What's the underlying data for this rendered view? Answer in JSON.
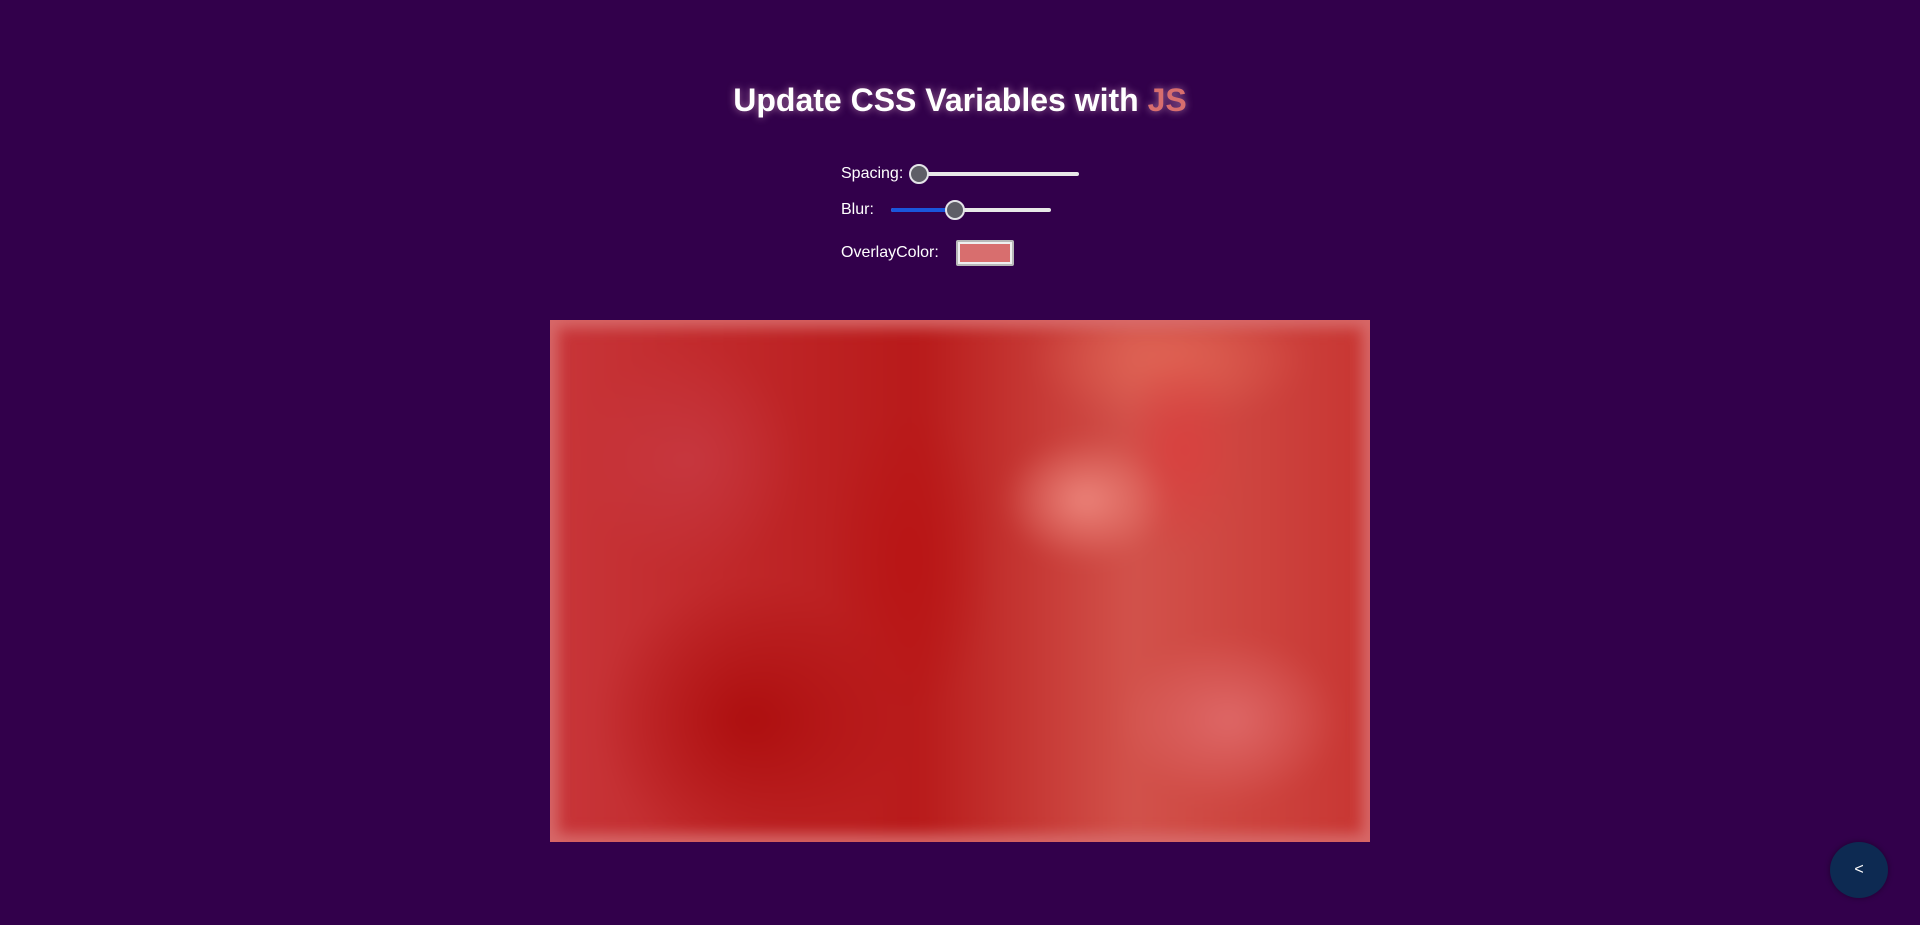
{
  "title": {
    "text": "Update CSS Variables with ",
    "highlight": "JS"
  },
  "controls": {
    "spacing": {
      "label": "Spacing:",
      "value": 0,
      "min": 0,
      "max": 200
    },
    "blur": {
      "label": "Blur:",
      "value": 10,
      "min": 0,
      "max": 25
    },
    "overlay_color": {
      "label": "OverlayColor:",
      "value": "#d86e6e"
    }
  },
  "colors": {
    "background": "#32004b",
    "accent": "#d86e6e",
    "slider_fill": "#1a56db",
    "back_button": "#0d2a52"
  },
  "back_button": {
    "label": "<",
    "icon": "chevron-left-icon"
  }
}
